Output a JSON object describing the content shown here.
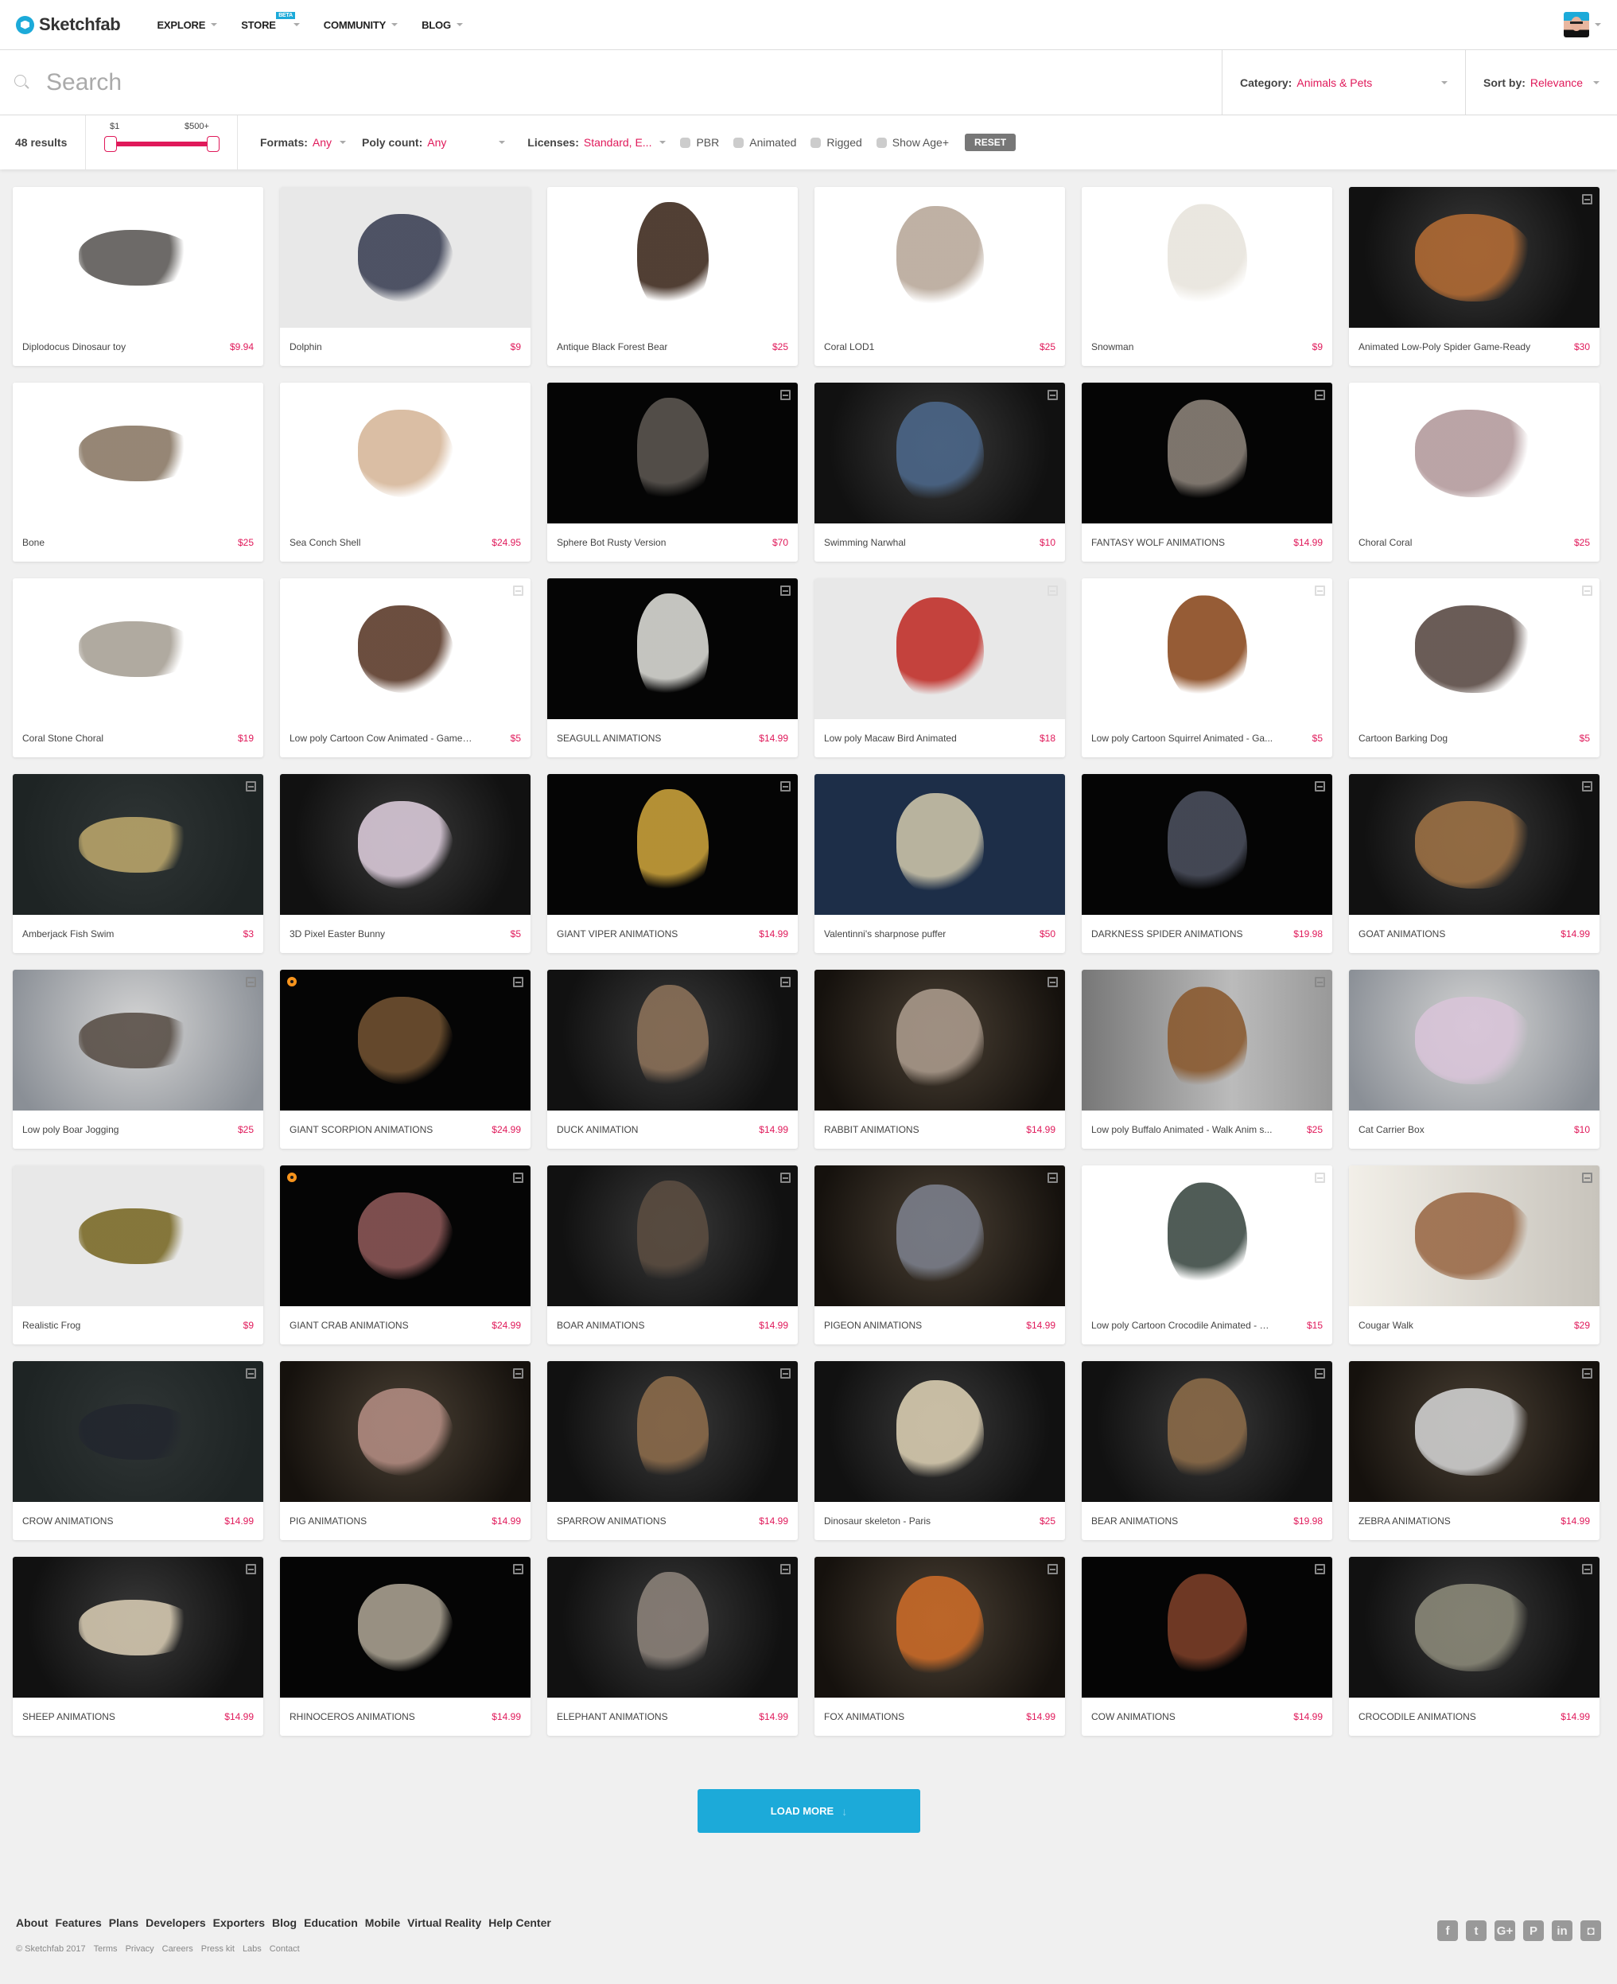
{
  "header": {
    "logo": "Sketchfab",
    "nav": [
      {
        "label": "EXPLORE"
      },
      {
        "label": "STORE",
        "badge": "BETA"
      },
      {
        "label": "COMMUNITY"
      },
      {
        "label": "BLOG"
      }
    ]
  },
  "search": {
    "placeholder": "Search",
    "value": "",
    "category_label": "Category:",
    "category_value": "Animals & Pets",
    "sort_label": "Sort by:",
    "sort_value": "Relevance"
  },
  "filters": {
    "results": "48 results",
    "price_min": "$1",
    "price_max": "$500+",
    "formats_label": "Formats:",
    "formats_value": "Any",
    "poly_label": "Poly count:",
    "poly_value": "Any",
    "licenses_label": "Licenses:",
    "licenses_value": "Standard, E...",
    "checkboxes": [
      "PBR",
      "Animated",
      "Rigged",
      "Show Age+"
    ],
    "reset": "RESET"
  },
  "accent_colors": {
    "primary": "#1caad9",
    "price": "#e0195a",
    "staff_pick": "#f7941d"
  },
  "models": [
    {
      "title": "Diplodocus Dinosaur toy",
      "price": "$9.94",
      "bg": "white",
      "color": "#5d5a57",
      "animated": false,
      "staff": false
    },
    {
      "title": "Dolphin",
      "price": "$9",
      "bg": "lightgray",
      "color": "#3d4256",
      "animated": false,
      "staff": false
    },
    {
      "title": "Antique Black Forest Bear",
      "price": "$25",
      "bg": "white",
      "color": "#3e2a1e",
      "animated": false,
      "staff": false
    },
    {
      "title": "Coral LOD1",
      "price": "$25",
      "bg": "white",
      "color": "#b8a89a",
      "animated": false,
      "staff": false
    },
    {
      "title": "Snowman",
      "price": "$9",
      "bg": "white",
      "color": "#e8e4dc",
      "animated": false,
      "staff": false
    },
    {
      "title": "Animated Low-Poly Spider Game-Ready",
      "price": "$30",
      "bg": "dark",
      "color": "#b06a34",
      "animated": true,
      "staff": false
    },
    {
      "title": "Bone",
      "price": "$25",
      "bg": "white",
      "color": "#8a7966",
      "animated": false,
      "staff": false
    },
    {
      "title": "Sea Conch Shell",
      "price": "$24.95",
      "bg": "white",
      "color": "#d6b79a",
      "animated": false,
      "staff": false
    },
    {
      "title": "Sphere Bot Rusty Version",
      "price": "$70",
      "bg": "black",
      "color": "#5a5550",
      "animated": true,
      "staff": false
    },
    {
      "title": "Swimming Narwhal",
      "price": "$10",
      "bg": "dark",
      "color": "#4b6688",
      "animated": true,
      "staff": false
    },
    {
      "title": "FANTASY WOLF ANIMATIONS",
      "price": "$14.99",
      "bg": "black",
      "color": "#8a8178",
      "animated": true,
      "staff": false
    },
    {
      "title": "Choral Coral",
      "price": "$25",
      "bg": "white",
      "color": "#b39a9c",
      "animated": false,
      "staff": false
    },
    {
      "title": "Coral Stone Choral",
      "price": "$19",
      "bg": "white",
      "color": "#a7a095",
      "animated": false,
      "staff": false
    },
    {
      "title": "Low poly Cartoon Cow Animated - Game ...",
      "price": "$5",
      "bg": "white",
      "color": "#5b3a2a",
      "animated": true,
      "staff": false
    },
    {
      "title": "SEAGULL ANIMATIONS",
      "price": "$14.99",
      "bg": "black",
      "color": "#d9d9d4",
      "animated": true,
      "staff": false
    },
    {
      "title": "Low poly Macaw Bird Animated",
      "price": "$18",
      "bg": "lightgray",
      "color": "#c0302a",
      "animated": true,
      "staff": false
    },
    {
      "title": "Low poly Cartoon Squirrel Animated - Ga...",
      "price": "$5",
      "bg": "white",
      "color": "#8a4a20",
      "animated": true,
      "staff": false
    },
    {
      "title": "Cartoon Barking Dog",
      "price": "$5",
      "bg": "white",
      "color": "#5a4a44",
      "animated": true,
      "staff": false
    },
    {
      "title": "Amberjack Fish Swim",
      "price": "$3",
      "bg": "slate",
      "color": "#b8a46a",
      "animated": true,
      "staff": false
    },
    {
      "title": "3D Pixel Easter Bunny",
      "price": "$5",
      "bg": "dark",
      "color": "#d9c9d8",
      "animated": false,
      "staff": false
    },
    {
      "title": "GIANT VIPER ANIMATIONS",
      "price": "$14.99",
      "bg": "black",
      "color": "#c8a03a",
      "animated": true,
      "staff": false
    },
    {
      "title": "Valentinni's sharpnose puffer",
      "price": "$50",
      "bg": "navy",
      "color": "#c9c2a8",
      "animated": false,
      "staff": false
    },
    {
      "title": "DARKNESS SPIDER ANIMATIONS",
      "price": "$19.98",
      "bg": "black",
      "color": "#4a4e5c",
      "animated": true,
      "staff": false
    },
    {
      "title": "GOAT ANIMATIONS",
      "price": "$14.99",
      "bg": "dark",
      "color": "#9b7044",
      "animated": true,
      "staff": false
    },
    {
      "title": "Low poly Boar Jogging",
      "price": "$25",
      "bg": "gray",
      "color": "#5a5048",
      "animated": true,
      "staff": false
    },
    {
      "title": "GIANT SCORPION ANIMATIONS",
      "price": "$24.99",
      "bg": "black",
      "color": "#6e5030",
      "animated": true,
      "staff": true
    },
    {
      "title": "DUCK ANIMATION",
      "price": "$14.99",
      "bg": "dark",
      "color": "#8a7058",
      "animated": true,
      "staff": false
    },
    {
      "title": "RABBIT ANIMATIONS",
      "price": "$14.99",
      "bg": "brown",
      "color": "#a8988a",
      "animated": true,
      "staff": false
    },
    {
      "title": "Low poly Buffalo Animated - Walk Anim s...",
      "price": "$25",
      "bg": "greyfade",
      "color": "#8a5a30",
      "animated": true,
      "staff": false
    },
    {
      "title": "Cat Carrier Box",
      "price": "$10",
      "bg": "gray",
      "color": "#d8c4d8",
      "animated": false,
      "staff": false
    },
    {
      "title": "Realistic Frog",
      "price": "$9",
      "bg": "lightgray",
      "color": "#7a6a28",
      "animated": false,
      "staff": false
    },
    {
      "title": "GIANT CRAB ANIMATIONS",
      "price": "$24.99",
      "bg": "black",
      "color": "#8a5656",
      "animated": true,
      "staff": true
    },
    {
      "title": "BOAR ANIMATIONS",
      "price": "$14.99",
      "bg": "dark",
      "color": "#5a4c40",
      "animated": true,
      "staff": false
    },
    {
      "title": "PIGEON ANIMATIONS",
      "price": "$14.99",
      "bg": "brown",
      "color": "#7a7e8a",
      "animated": true,
      "staff": false
    },
    {
      "title": "Low poly Cartoon Crocodile Animated - G...",
      "price": "$15",
      "bg": "white",
      "color": "#3c4a44",
      "animated": true,
      "staff": false
    },
    {
      "title": "Cougar Walk",
      "price": "$29",
      "bg": "cream",
      "color": "#9a6a48",
      "animated": true,
      "staff": false
    },
    {
      "title": "CROW ANIMATIONS",
      "price": "$14.99",
      "bg": "slate",
      "color": "#22262e",
      "animated": true,
      "staff": false
    },
    {
      "title": "PIG ANIMATIONS",
      "price": "$14.99",
      "bg": "brown",
      "color": "#b08a80",
      "animated": true,
      "staff": false
    },
    {
      "title": "SPARROW ANIMATIONS",
      "price": "$14.99",
      "bg": "dark",
      "color": "#8a6a4a",
      "animated": true,
      "staff": false
    },
    {
      "title": "Dinosaur skeleton - Paris",
      "price": "$25",
      "bg": "dark",
      "color": "#d8ccb0",
      "animated": false,
      "staff": false
    },
    {
      "title": "BEAR ANIMATIONS",
      "price": "$19.98",
      "bg": "dark",
      "color": "#8a6a48",
      "animated": true,
      "staff": false
    },
    {
      "title": "ZEBRA ANIMATIONS",
      "price": "$14.99",
      "bg": "brown",
      "color": "#cfcfcf",
      "animated": true,
      "staff": false
    },
    {
      "title": "SHEEP ANIMATIONS",
      "price": "$14.99",
      "bg": "dark",
      "color": "#d4c8b0",
      "animated": true,
      "staff": false
    },
    {
      "title": "RHINOCEROS ANIMATIONS",
      "price": "$14.99",
      "bg": "black",
      "color": "#a8a090",
      "animated": true,
      "staff": false
    },
    {
      "title": "ELEPHANT ANIMATIONS",
      "price": "$14.99",
      "bg": "dark",
      "color": "#8a8078",
      "animated": true,
      "staff": false
    },
    {
      "title": "FOX ANIMATIONS",
      "price": "$14.99",
      "bg": "brown",
      "color": "#c86a28",
      "animated": true,
      "staff": false
    },
    {
      "title": "COW ANIMATIONS",
      "price": "$14.99",
      "bg": "black",
      "color": "#7a3e28",
      "animated": true,
      "staff": false
    },
    {
      "title": "CROCODILE ANIMATIONS",
      "price": "$14.99",
      "bg": "dark",
      "color": "#8a8878",
      "animated": true,
      "staff": false
    }
  ],
  "load_more": "LOAD MORE",
  "footer": {
    "links": [
      "About",
      "Features",
      "Plans",
      "Developers",
      "Exporters",
      "Blog",
      "Education",
      "Mobile",
      "Virtual Reality",
      "Help Center"
    ],
    "legal": [
      "© Sketchfab 2017",
      "Terms",
      "Privacy",
      "Careers",
      "Press kit",
      "Labs",
      "Contact"
    ],
    "social": [
      {
        "name": "facebook-icon",
        "glyph": "f"
      },
      {
        "name": "twitter-icon",
        "glyph": "t"
      },
      {
        "name": "google-plus-icon",
        "glyph": "G+"
      },
      {
        "name": "pinterest-icon",
        "glyph": "P"
      },
      {
        "name": "linkedin-icon",
        "glyph": "in"
      },
      {
        "name": "instagram-icon",
        "glyph": "◘"
      }
    ]
  }
}
